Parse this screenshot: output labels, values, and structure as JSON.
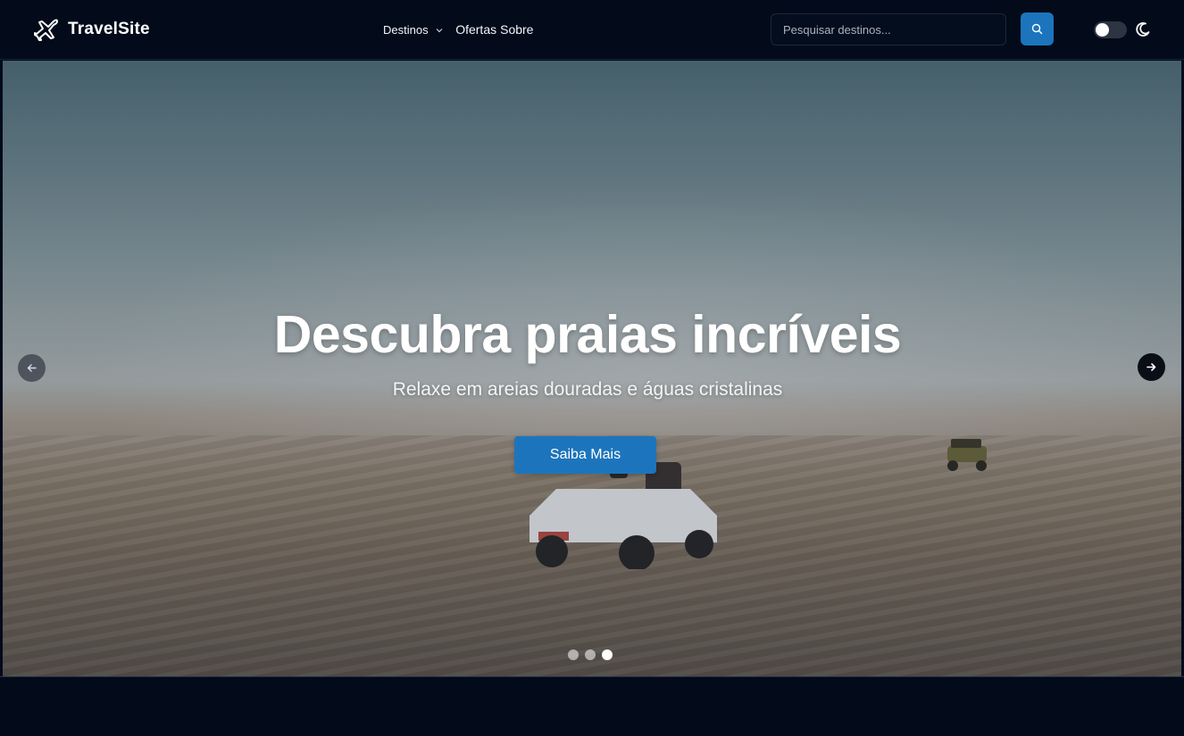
{
  "navbar": {
    "brand": "TravelSite",
    "brand_icon": "airplane-icon",
    "links": {
      "destinos": "Destinos",
      "ofertas": "Ofertas",
      "sobre": "Sobre"
    },
    "search_placeholder": "Pesquisar destinos...",
    "search_icon": "search-icon",
    "theme_icon": "moon-icon"
  },
  "hero": {
    "title": "Descubra praias incríveis",
    "subtitle": "Relaxe em areias douradas e águas cristalinas",
    "cta_label": "Saiba Mais",
    "slides": [
      {
        "active": false
      },
      {
        "active": false
      },
      {
        "active": true
      }
    ],
    "prev_icon": "arrow-left-icon",
    "next_icon": "arrow-right-icon"
  },
  "colors": {
    "nav_bg": "#030b1a",
    "accent": "#1c75bc",
    "text": "#ffffff"
  }
}
